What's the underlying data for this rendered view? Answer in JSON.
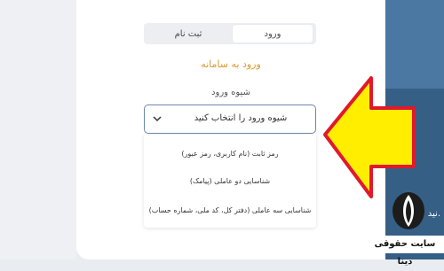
{
  "tabs": [
    {
      "label": "ورود",
      "active": true
    },
    {
      "label": "ثبت نام",
      "active": false
    }
  ],
  "heading": "ورود به سامانه",
  "method": {
    "label": "شیوه ورود",
    "selected": "شیوه ورود را انتخاب کنید",
    "options": [
      "رمز ثابت (نام کاربری، رمز عبور)",
      "شناسایی دو عاملی (پیامک)",
      "شناسایی سه عاملی (دفتر کل، کد ملی، شماره حساب)"
    ]
  },
  "side_panel": {
    "text": "نید."
  },
  "watermark": {
    "text": "سایت حقوقی دینا"
  },
  "colors": {
    "accent": "#d89a2c",
    "arrow_fill": "#ffee00",
    "arrow_stroke": "#e0192c",
    "panel": "#2f5f8c"
  }
}
